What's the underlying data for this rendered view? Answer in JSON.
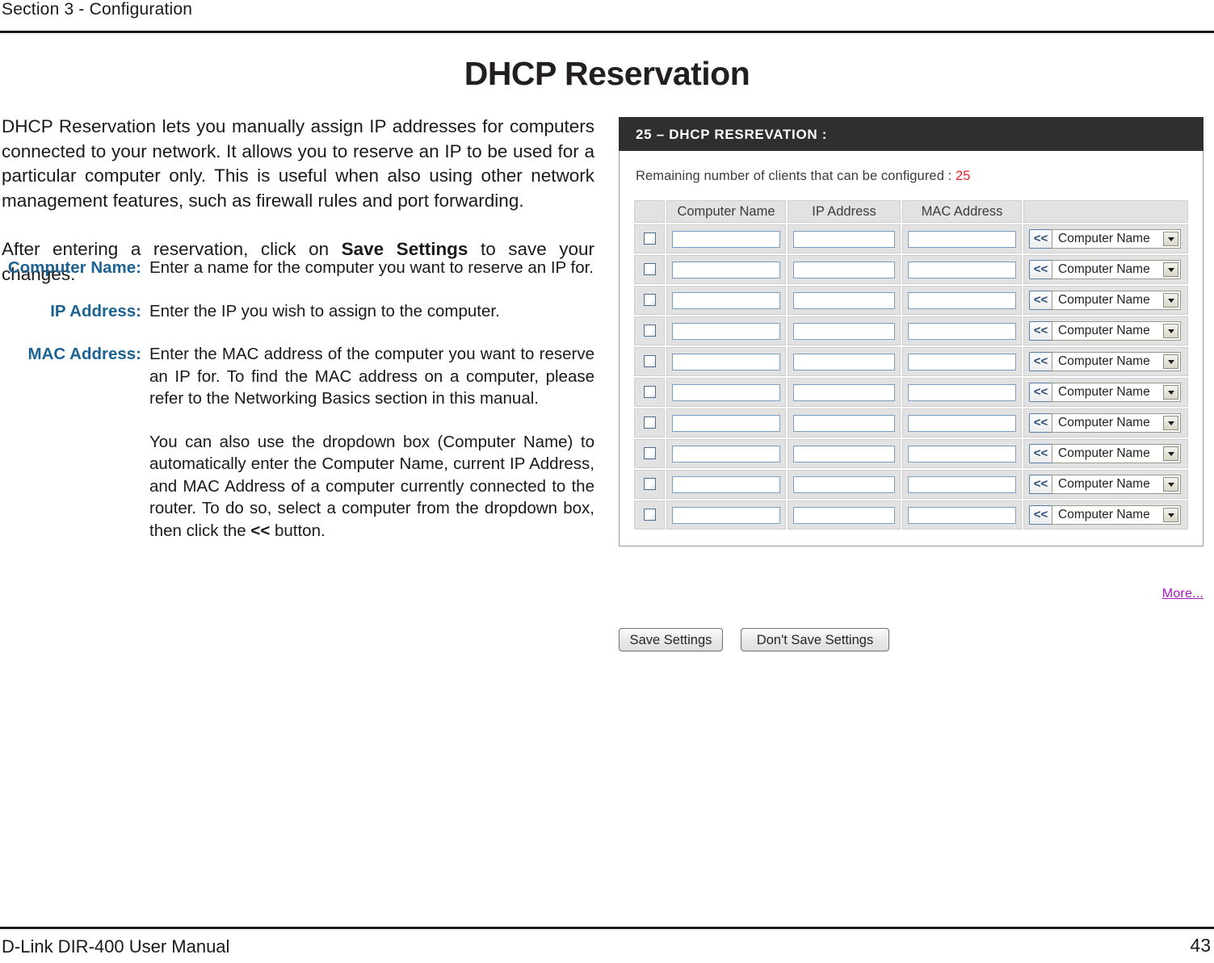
{
  "header": {
    "section_label": "Section 3 - Configuration"
  },
  "title": "DHCP Reservation",
  "intro": {
    "para1": "DHCP Reservation lets you manually assign IP addresses for computers connected to your network.  It allows you to reserve an IP to be used for a particular computer only. This is useful when also using other network management features, such as firewall rules and port forwarding.",
    "para2_before": "After entering a reservation, click on ",
    "para2_bold": "Save Settings",
    "para2_after": " to save your changes."
  },
  "definitions": [
    {
      "term": "Computer Name:",
      "desc": "Enter a name for the computer you want to reserve an IP for."
    },
    {
      "term": "IP Address:",
      "desc": "Enter the IP you wish to assign to the computer."
    },
    {
      "term": "MAC Address:",
      "desc": "Enter the MAC address of the computer you want to reserve an IP for. To find the MAC address on a computer, please refer to the Networking Basics section in this manual."
    }
  ],
  "continuation": {
    "before": "You can also use the dropdown box (Computer Name) to automatically enter the Computer Name, current IP Address, and MAC Address of a computer currently connected to the router.  To do so, select a computer from the dropdown box, then click the ",
    "bold": "<<",
    "after": " button."
  },
  "ui_panel": {
    "titlebar": "25 – DHCP RESREVATION :",
    "remaining_label": "Remaining number of clients that can be configured : ",
    "remaining_count": "25",
    "accent_red": "#e8222b",
    "table": {
      "columns": [
        "",
        "Computer Name",
        "IP Address",
        "MAC Address",
        ""
      ],
      "row_count": 10,
      "copy_button_label": "<<",
      "dropdown_value": "Computer Name",
      "input_value": ""
    },
    "more_link": "More...",
    "buttons": {
      "save": "Save Settings",
      "dont_save": "Don't Save Settings"
    }
  },
  "footer": {
    "manual": "D-Link DIR-400 User Manual",
    "page": "43"
  },
  "colors": {
    "label_blue": "#1c6394",
    "titlebar_dark": "#2f2f2f",
    "link_purple": "#a617c0"
  }
}
